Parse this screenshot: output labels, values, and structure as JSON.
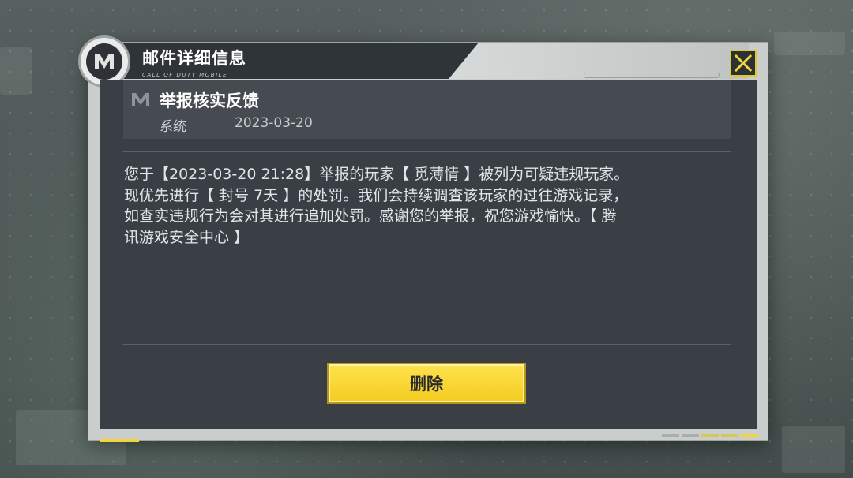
{
  "window": {
    "title": "邮件详细信息",
    "subtitle": "CALL OF DUTY MOBILE"
  },
  "mail": {
    "subject": "举报核实反馈",
    "sender": "系统",
    "date": "2023-03-20",
    "body": "您于【2023-03-20 21:28】举报的玩家【 觅薄情 】被列为可疑违规玩家。\n现优先进行【 封号 7天 】的处罚。我们会持续调查该玩家的过往游戏记录，\n如查实违规行为会对其进行追加处罚。感谢您的举报，祝您游戏愉快。【 腾\n讯游戏安全中心 】"
  },
  "actions": {
    "delete_label": "删除"
  },
  "icons": {
    "logo": "cod-mobile-logo-icon",
    "close": "close-icon",
    "mail": "cod-logo-small-icon"
  },
  "colors": {
    "accent": "#f2d43b",
    "panel": "#393f45",
    "header_card": "#454b51"
  },
  "pager": {
    "total": 5,
    "active": 3
  }
}
